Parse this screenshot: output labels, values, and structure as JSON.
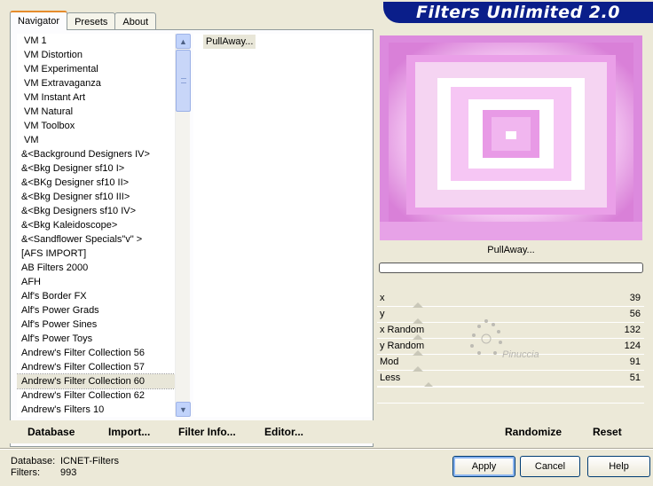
{
  "banner": {
    "title": "Filters Unlimited 2.0"
  },
  "tabs": [
    {
      "label": "Navigator",
      "active": true
    },
    {
      "label": "Presets",
      "active": false
    },
    {
      "label": "About",
      "active": false
    }
  ],
  "filter_list": {
    "items": [
      "VM 1",
      "VM Distortion",
      "VM Experimental",
      "VM Extravaganza",
      "VM Instant Art",
      "VM Natural",
      "VM Toolbox",
      "VM",
      "&<Background Designers IV>",
      "&<Bkg Designer sf10 I>",
      "&<BKg Designer sf10 II>",
      "&<Bkg Designer sf10 III>",
      "&<Bkg Designers sf10 IV>",
      "&<Bkg Kaleidoscope>",
      "&<Sandflower Specials\"v\" >",
      "[AFS IMPORT]",
      "AB Filters 2000",
      "AFH",
      "Alf's Border FX",
      "Alf's Power Grads",
      "Alf's Power Sines",
      "Alf's Power Toys",
      "Andrew's Filter Collection 56",
      "Andrew's Filter Collection 57",
      "Andrew's Filter Collection 60",
      "Andrew's Filter Collection 62",
      "Andrew's Filters 10"
    ],
    "selected_index": 24
  },
  "sub_list": {
    "items": [
      "PullAway..."
    ]
  },
  "left_buttons": {
    "database": "Database",
    "import": "Import...",
    "filter_info": "Filter Info...",
    "editor": "Editor..."
  },
  "preview": {
    "label": "PullAway...",
    "progress": 0
  },
  "params": [
    {
      "label": "x",
      "value": "39"
    },
    {
      "label": "y",
      "value": "56"
    },
    {
      "label": "x Random",
      "value": "132"
    },
    {
      "label": "y Random",
      "value": "124"
    },
    {
      "label": "Mod",
      "value": "91"
    },
    {
      "label": "Less",
      "value": "51"
    }
  ],
  "right_buttons": {
    "randomize": "Randomize",
    "reset": "Reset"
  },
  "watermark": "Pinuccia",
  "status": {
    "database_label": "Database:",
    "database_value": "ICNET-Filters",
    "filters_label": "Filters:",
    "filters_value": "993"
  },
  "actions": {
    "apply": "Apply",
    "cancel": "Cancel",
    "help": "Help"
  },
  "colors": {
    "banner": "#0a1e8a",
    "tab_highlight": "#e68b2c",
    "preview": "#dd88dd"
  }
}
